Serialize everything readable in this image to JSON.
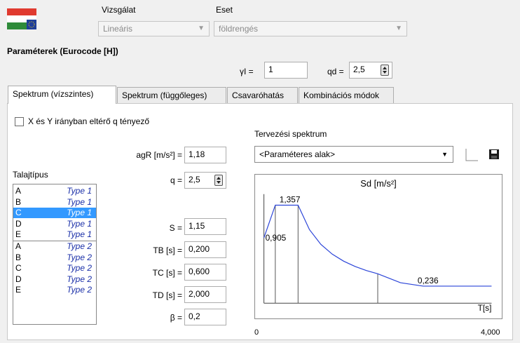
{
  "header": {
    "vizsgalat_label": "Vizsgálat",
    "vizsgalat_value": "Lineáris",
    "eset_label": "Eset",
    "eset_value": "földrengés"
  },
  "params": {
    "title": "Paraméterek (Eurocode [H])",
    "gamma_label": "γI =",
    "gamma_value": "1",
    "qd_label": "qd =",
    "qd_value": "2,5"
  },
  "tabs": [
    {
      "label": "Spektrum (vízszintes)"
    },
    {
      "label": "Spektrum (függőleges)"
    },
    {
      "label": "Csavaróhatás"
    },
    {
      "label": "Kombinációs módok"
    }
  ],
  "checkbox": {
    "label": "X és Y irányban eltérő q tényező"
  },
  "soil": {
    "title": "Talajtípus",
    "items": [
      {
        "a": "A",
        "b": "Type 1"
      },
      {
        "a": "B",
        "b": "Type 1"
      },
      {
        "a": "C",
        "b": "Type 1"
      },
      {
        "a": "D",
        "b": "Type 1"
      },
      {
        "a": "E",
        "b": "Type 1"
      },
      {
        "a": "A",
        "b": "Type 2"
      },
      {
        "a": "B",
        "b": "Type 2"
      },
      {
        "a": "C",
        "b": "Type 2"
      },
      {
        "a": "D",
        "b": "Type 2"
      },
      {
        "a": "E",
        "b": "Type 2"
      }
    ]
  },
  "fields": {
    "agr_label": "agR [m/s²] =",
    "agr_value": "1,18",
    "q_label": "q =",
    "q_value": "2,5",
    "s_label": "S =",
    "s_value": "1,15",
    "tb_label": "TB [s] =",
    "tb_value": "0,200",
    "tc_label": "TC [s] =",
    "tc_value": "0,600",
    "td_label": "TD [s] =",
    "td_value": "2,000",
    "beta_label": "β =",
    "beta_value": "0,2"
  },
  "spectrum": {
    "title": "Tervezési spektrum",
    "dropdown_value": "<Paraméteres alak>"
  },
  "chart_data": {
    "type": "line",
    "title": "Sd [m/s²]",
    "xlabel": "T[s]",
    "x_tick_labels": [
      "0",
      "4,000"
    ],
    "xlim": [
      0,
      4.0
    ],
    "ylim": [
      0,
      1.5
    ],
    "annotations": [
      "1,357",
      "0,905",
      "0,236"
    ],
    "series": [
      {
        "x": [
          0,
          0.2,
          0.6,
          0.8,
          1.0,
          1.2,
          1.4,
          1.6,
          1.8,
          2.0,
          2.4,
          2.8,
          3.2,
          3.6,
          4.0
        ],
        "y": [
          0.905,
          1.357,
          1.357,
          1.018,
          0.814,
          0.679,
          0.582,
          0.509,
          0.452,
          0.407,
          0.283,
          0.236,
          0.236,
          0.236,
          0.236
        ]
      }
    ],
    "markers_x": [
      0.2,
      0.6,
      2.0
    ]
  }
}
